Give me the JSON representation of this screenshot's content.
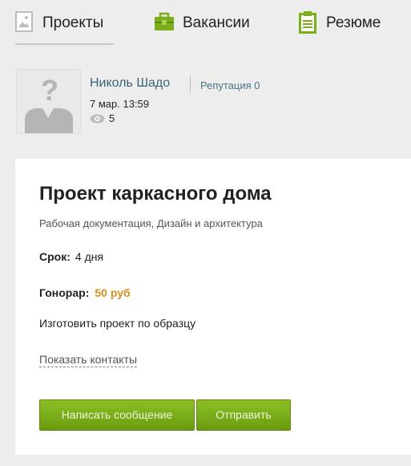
{
  "tabs": [
    {
      "label": "Проекты",
      "icon": "image-icon"
    },
    {
      "label": "Вакансии",
      "icon": "briefcase-icon"
    },
    {
      "label": "Резюме",
      "icon": "clipboard-icon"
    }
  ],
  "author": {
    "name": "Николь Шадо",
    "reputation": "Репутация 0",
    "date": "7 мар. 13:59",
    "views": "5"
  },
  "project": {
    "title": "Проект каркасного дома",
    "category": "Рабочая документация, Дизайн и архитектура",
    "term_label": "Срок:",
    "term_value": "4 дня",
    "fee_label": "Гонорар:",
    "fee_value": "50 руб",
    "description": "Изготовить проект по образцу",
    "show_contacts": "Показать контакты"
  },
  "buttons": {
    "write_message": "Написать сообщение",
    "send": "Отправить"
  },
  "colors": {
    "accent_green": "#7bae1a",
    "fee_orange": "#d98d1a",
    "link_blue": "#3a6478"
  }
}
